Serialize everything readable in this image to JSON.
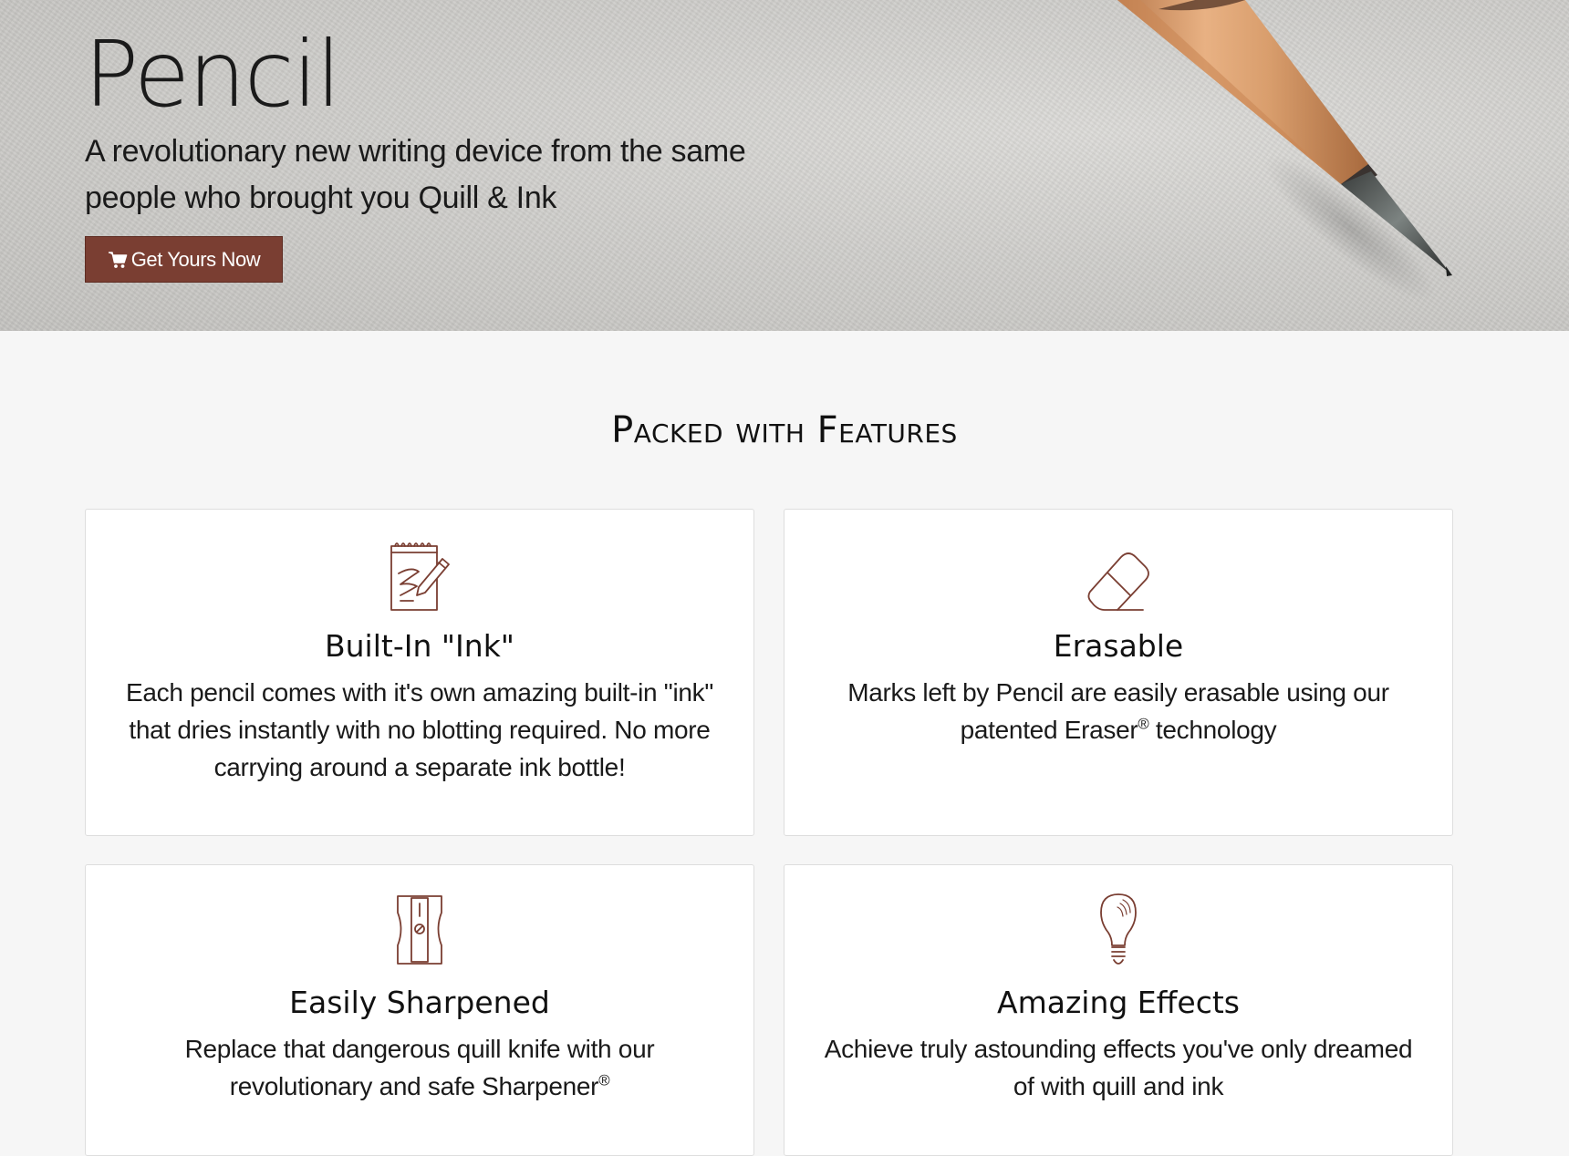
{
  "hero": {
    "title": "Pencil",
    "tagline": "A revolutionary new writing device from the same people who brought you Quill & Ink",
    "cta_label": "Get Yours Now",
    "cta_icon": "shopping-cart-icon"
  },
  "features": {
    "heading": "Packed with Features",
    "items": [
      {
        "icon": "notepad-pencil-icon",
        "title": "Built-In \"Ink\"",
        "text": "Each pencil comes with it's own amazing built-in \"ink\" that dries instantly with no blotting required. No more carrying around a separate ink bottle!"
      },
      {
        "icon": "eraser-icon",
        "title": "Erasable",
        "text_before": "Marks left by Pencil are easily erasable using our patented Eraser",
        "mark": "®",
        "text_after": " technology"
      },
      {
        "icon": "sharpener-icon",
        "title": "Easily Sharpened",
        "text_before": "Replace that dangerous quill knife with our revolutionary and safe Sharpener",
        "mark": "®",
        "text_after": ""
      },
      {
        "icon": "lightbulb-icon",
        "title": "Amazing Effects",
        "text": "Achieve truly astounding effects you've only dreamed of with quill and ink"
      }
    ]
  },
  "colors": {
    "accent": "#7a3e32",
    "icon_stroke": "#7a3e32",
    "page_background": "#f6f6f6",
    "card_background": "#ffffff"
  }
}
